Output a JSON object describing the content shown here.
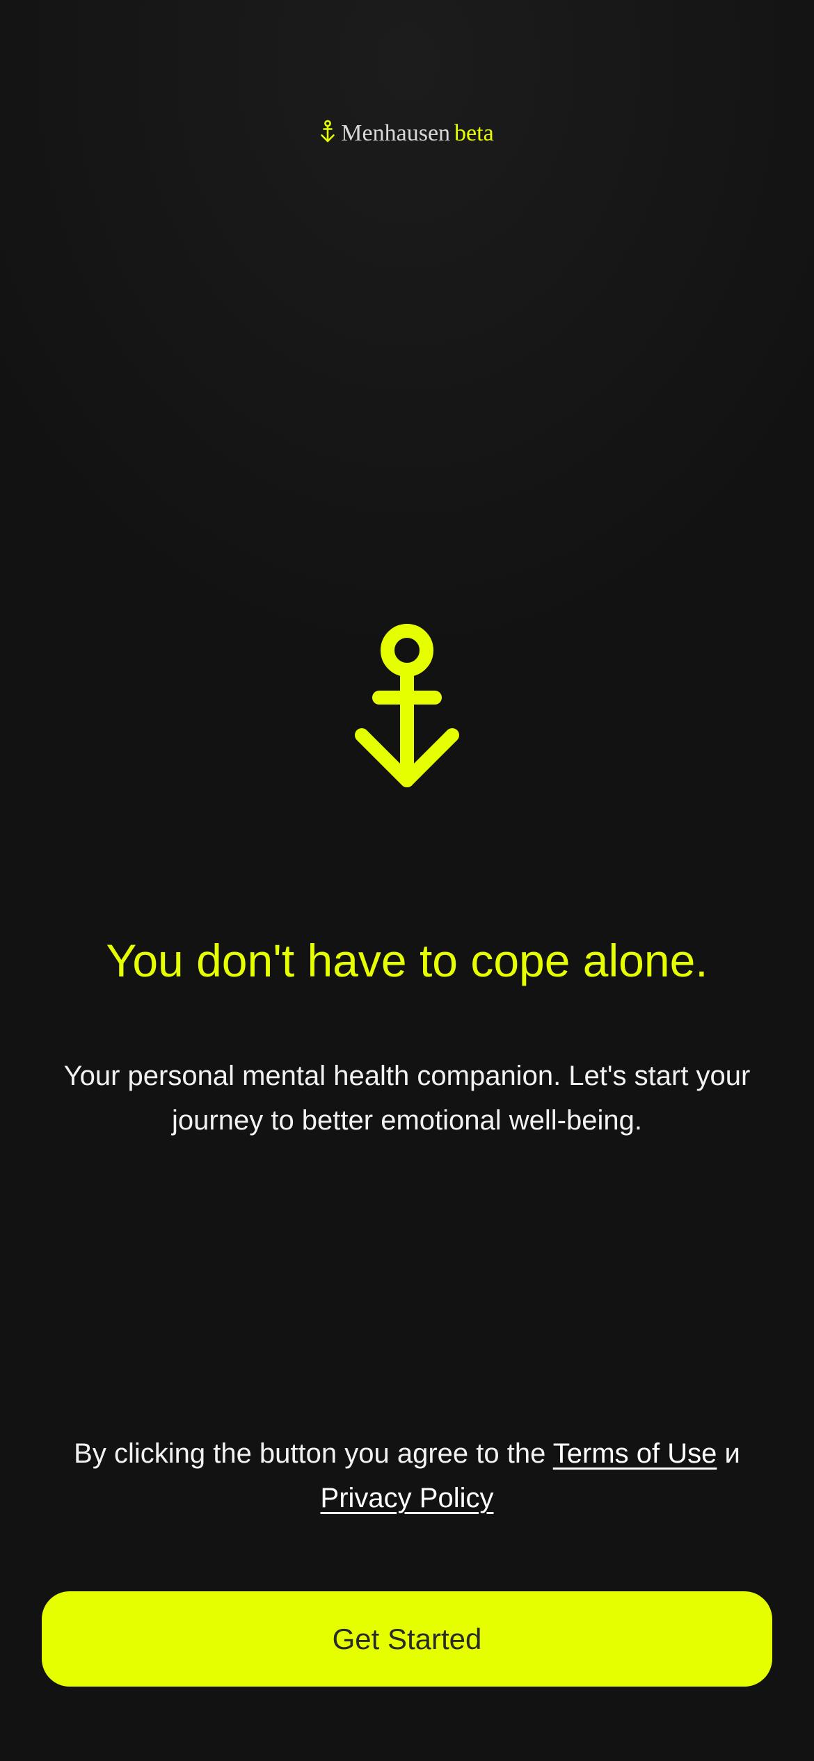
{
  "brand": {
    "name": "Menhausen",
    "badge": "beta"
  },
  "hero": {
    "icon": "anchor-icon",
    "headline": "You don't have to cope alone.",
    "subtitle": "Your personal mental health companion. Let's start your journey to better emotional well-being."
  },
  "legal": {
    "prefix": "By clicking the button you agree to the",
    "terms_link": "Terms of Use",
    "conjunction": "и",
    "privacy_link": "Privacy Policy"
  },
  "cta": {
    "label": "Get Started"
  },
  "colors": {
    "accent": "#e5ff00",
    "background": "#121212",
    "text": "#ffffff",
    "button_text": "#2a2a2a"
  }
}
